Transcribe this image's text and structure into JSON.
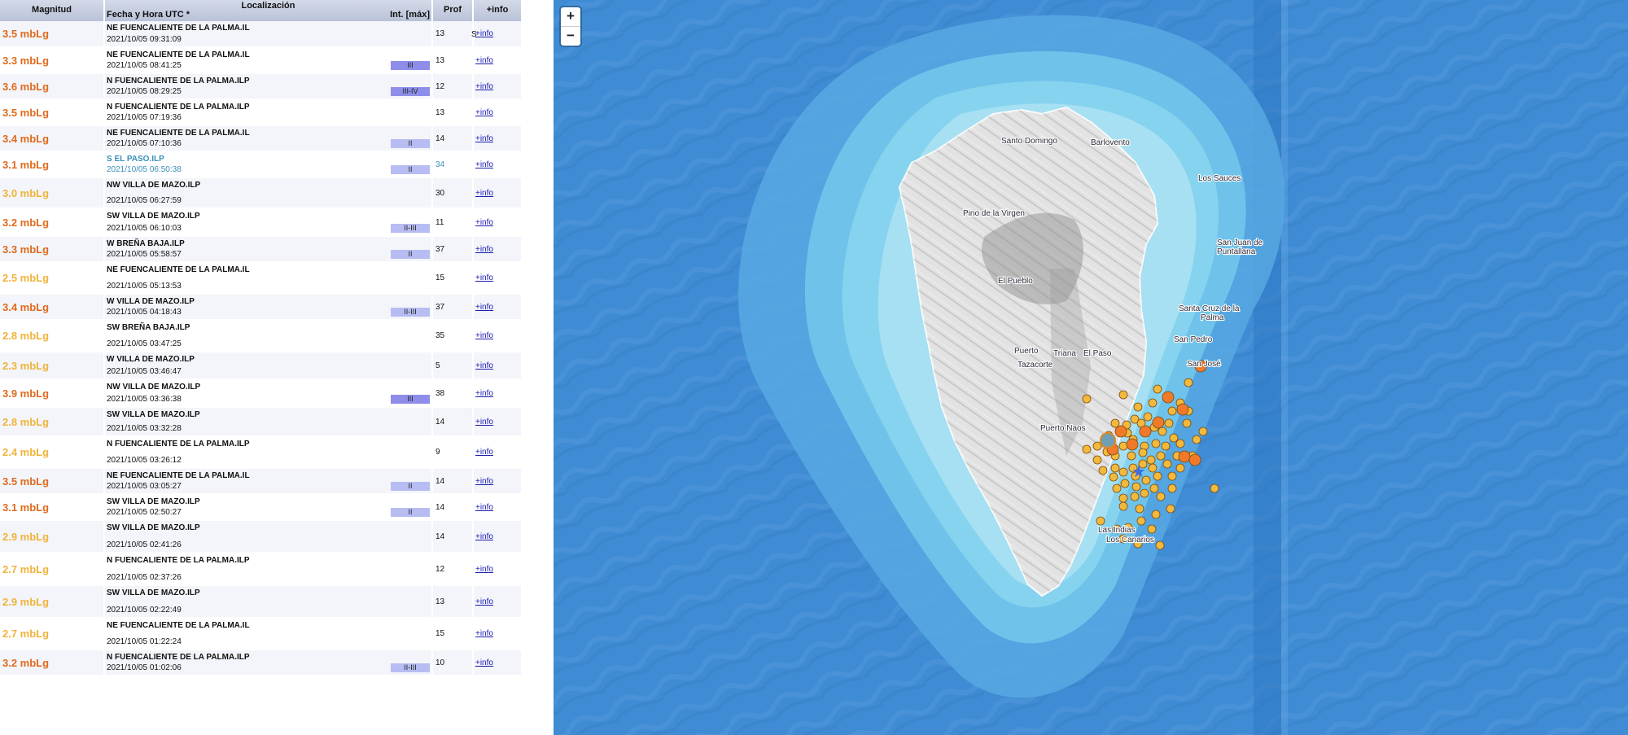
{
  "table": {
    "headers": {
      "magnitude": "Magnitud",
      "location": "Localización",
      "datetime": "Fecha y Hora UTC *",
      "intensity": "Int. [máx]",
      "depth": "Prof",
      "info": "+info"
    },
    "rows": [
      {
        "mag": "3.5 mbLg",
        "mag_color": "#e06a1d",
        "place": "NE FUENCALIENTE DE LA PALMA.IL",
        "datetime": "2021/10/05 09:31:09",
        "intensity": "",
        "int_color": "",
        "depth": "13",
        "info": "+info",
        "flag": "S",
        "height": 34
      },
      {
        "mag": "3.3 mbLg",
        "mag_color": "#e06a1d",
        "place": "NE FUENCALIENTE DE LA PALMA.IL",
        "datetime": "2021/10/05 08:41:25",
        "intensity": "III",
        "int_color": "#8e8eea",
        "depth": "13",
        "info": "+info",
        "flag": "",
        "height": 34
      },
      {
        "mag": "3.6 mbLg",
        "mag_color": "#e06a1d",
        "place": "N FUENCALIENTE DE LA PALMA.ILP",
        "datetime": "2021/10/05 08:29:25",
        "intensity": "III-IV",
        "int_color": "#8e8eea",
        "depth": "12",
        "info": "+info",
        "flag": "",
        "height": 34
      },
      {
        "mag": "3.5 mbLg",
        "mag_color": "#e06a1d",
        "place": "N FUENCALIENTE DE LA PALMA.ILP",
        "datetime": "2021/10/05 07:19:36",
        "intensity": "",
        "int_color": "",
        "depth": "13",
        "info": "+info",
        "flag": "",
        "height": 34
      },
      {
        "mag": "3.4 mbLg",
        "mag_color": "#e06a1d",
        "place": "NE FUENCALIENTE DE LA PALMA.IL",
        "datetime": "2021/10/05 07:10:36",
        "intensity": "II",
        "int_color": "#b7bdf2",
        "depth": "14",
        "info": "+info",
        "flag": "",
        "height": 34
      },
      {
        "mag": "3.1 mbLg",
        "mag_color": "#e06a1d",
        "place": "S EL PASO.ILP",
        "datetime": "2021/10/05 06:50:38",
        "intensity": "II",
        "int_color": "#b7bdf2",
        "depth": "34",
        "info": "+info",
        "flag": "",
        "height": 34,
        "blue": true
      },
      {
        "mag": "3.0 mbLg",
        "mag_color": "#f0b33a",
        "place": "NW VILLA DE MAZO.ILP",
        "datetime": "2021/10/05 06:27:59",
        "intensity": "",
        "int_color": "",
        "depth": "30",
        "info": "+info",
        "flag": "",
        "height": 40
      },
      {
        "mag": "3.2 mbLg",
        "mag_color": "#e06a1d",
        "place": "SW VILLA DE MAZO.ILP",
        "datetime": "2021/10/05 06:10:03",
        "intensity": "II-III",
        "int_color": "#b7bdf2",
        "depth": "11",
        "info": "+info",
        "flag": "",
        "height": 36
      },
      {
        "mag": "3.3 mbLg",
        "mag_color": "#e06a1d",
        "place": "W BREÑA BAJA.ILP",
        "datetime": "2021/10/05 05:58:57",
        "intensity": "II",
        "int_color": "#b7bdf2",
        "depth": "37",
        "info": "+info",
        "flag": "",
        "height": 34
      },
      {
        "mag": "2.5 mbLg",
        "mag_color": "#f0b33a",
        "place": "NE FUENCALIENTE DE LA PALMA.IL",
        "datetime": "2021/10/05 05:13:53",
        "intensity": "",
        "int_color": "",
        "depth": "15",
        "info": "+info",
        "flag": "",
        "height": 41
      },
      {
        "mag": "3.4 mbLg",
        "mag_color": "#e06a1d",
        "place": "W VILLA DE MAZO.ILP",
        "datetime": "2021/10/05 04:18:43",
        "intensity": "II-III",
        "int_color": "#b7bdf2",
        "depth": "37",
        "info": "+info",
        "flag": "",
        "height": 34
      },
      {
        "mag": "2.8 mbLg",
        "mag_color": "#f0b33a",
        "place": "SW BREÑA BAJA.ILP",
        "datetime": "2021/10/05 03:47:25",
        "intensity": "",
        "int_color": "",
        "depth": "35",
        "info": "+info",
        "flag": "",
        "height": 41
      },
      {
        "mag": "2.3 mbLg",
        "mag_color": "#f0b33a",
        "place": "W VILLA DE MAZO.ILP",
        "datetime": "2021/10/05 03:46:47",
        "intensity": "",
        "int_color": "",
        "depth": "5",
        "info": "+info",
        "flag": "",
        "height": 36
      },
      {
        "mag": "3.9 mbLg",
        "mag_color": "#e06a1d",
        "place": "NW VILLA DE MAZO.ILP",
        "datetime": "2021/10/05 03:36:38",
        "intensity": "III",
        "int_color": "#8e8eea",
        "depth": "38",
        "info": "+info",
        "flag": "",
        "height": 36
      },
      {
        "mag": "2.8 mbLg",
        "mag_color": "#f0b33a",
        "place": "SW VILLA DE MAZO.ILP",
        "datetime": "2021/10/05 03:32:28",
        "intensity": "",
        "int_color": "",
        "depth": "14",
        "info": "+info",
        "flag": "",
        "height": 38
      },
      {
        "mag": "2.4 mbLg",
        "mag_color": "#f0b33a",
        "place": "N FUENCALIENTE DE LA PALMA.ILP",
        "datetime": "2021/10/05 03:26:12",
        "intensity": "",
        "int_color": "",
        "depth": "9",
        "info": "+info",
        "flag": "",
        "height": 41
      },
      {
        "mag": "3.5 mbLg",
        "mag_color": "#e06a1d",
        "place": "NE FUENCALIENTE DE LA PALMA.IL",
        "datetime": "2021/10/05 03:05:27",
        "intensity": "II",
        "int_color": "#b7bdf2",
        "depth": "14",
        "info": "+info",
        "flag": "",
        "height": 34
      },
      {
        "mag": "3.1 mbLg",
        "mag_color": "#e06a1d",
        "place": "SW VILLA DE MAZO.ILP",
        "datetime": "2021/10/05 02:50:27",
        "intensity": "II",
        "int_color": "#b7bdf2",
        "depth": "14",
        "info": "+info",
        "flag": "",
        "height": 34
      },
      {
        "mag": "2.9 mbLg",
        "mag_color": "#f0b33a",
        "place": "SW VILLA DE MAZO.ILP",
        "datetime": "2021/10/05 02:41:26",
        "intensity": "",
        "int_color": "",
        "depth": "14",
        "info": "+info",
        "flag": "",
        "height": 42
      },
      {
        "mag": "2.7 mbLg",
        "mag_color": "#f0b33a",
        "place": "N FUENCALIENTE DE LA PALMA.ILP",
        "datetime": "2021/10/05 02:37:26",
        "intensity": "",
        "int_color": "",
        "depth": "12",
        "info": "+info",
        "flag": "",
        "height": 42
      },
      {
        "mag": "2.9 mbLg",
        "mag_color": "#f0b33a",
        "place": "SW VILLA DE MAZO.ILP",
        "datetime": "2021/10/05 02:22:49",
        "intensity": "",
        "int_color": "",
        "depth": "13",
        "info": "+info",
        "flag": "",
        "height": 42
      },
      {
        "mag": "2.7 mbLg",
        "mag_color": "#f0b33a",
        "place": "NE FUENCALIENTE DE LA PALMA.IL",
        "datetime": "2021/10/05 01:22:24",
        "intensity": "",
        "int_color": "",
        "depth": "15",
        "info": "+info",
        "flag": "",
        "height": 41
      },
      {
        "mag": "3.2 mbLg",
        "mag_color": "#e06a1d",
        "place": "N FUENCALIENTE DE LA PALMA.ILP",
        "datetime": "2021/10/05 01:02:06",
        "intensity": "II-III",
        "int_color": "#b7bdf2",
        "depth": "10",
        "info": "+info",
        "flag": "",
        "height": 34
      }
    ]
  },
  "map": {
    "zoom_in": "+",
    "zoom_out": "−",
    "towns": {
      "santo_domingo": "Santo Domingo",
      "barlovento": "Barlovento",
      "los_sauces": "Los Sauces",
      "pino_de_la_virgen": "Pino de la Virgen",
      "san_juan_1": "San Juan de",
      "san_juan_2": "Puntallana",
      "el_pueblo": "El Pueblo",
      "santa_cruz_1": "Santa Cruz de la",
      "santa_cruz_2": "Palma",
      "san_pedro": "San Pedro",
      "puerto_1": "Puerto",
      "puerto_2": "Tazacorte",
      "triana": "Triana",
      "el_paso": "El Paso",
      "san_jose": "San José",
      "puerto_naos": "Puerto Naos",
      "las_indias": "Las Indias",
      "los_canarios": "Los Canarios"
    },
    "marker_colors": {
      "small": "#f3b93c",
      "large": "#f07a2a",
      "highlight": "#6e9fb5",
      "star": "#3c6ee6"
    },
    "ocean_color": "#3f8cd4"
  }
}
